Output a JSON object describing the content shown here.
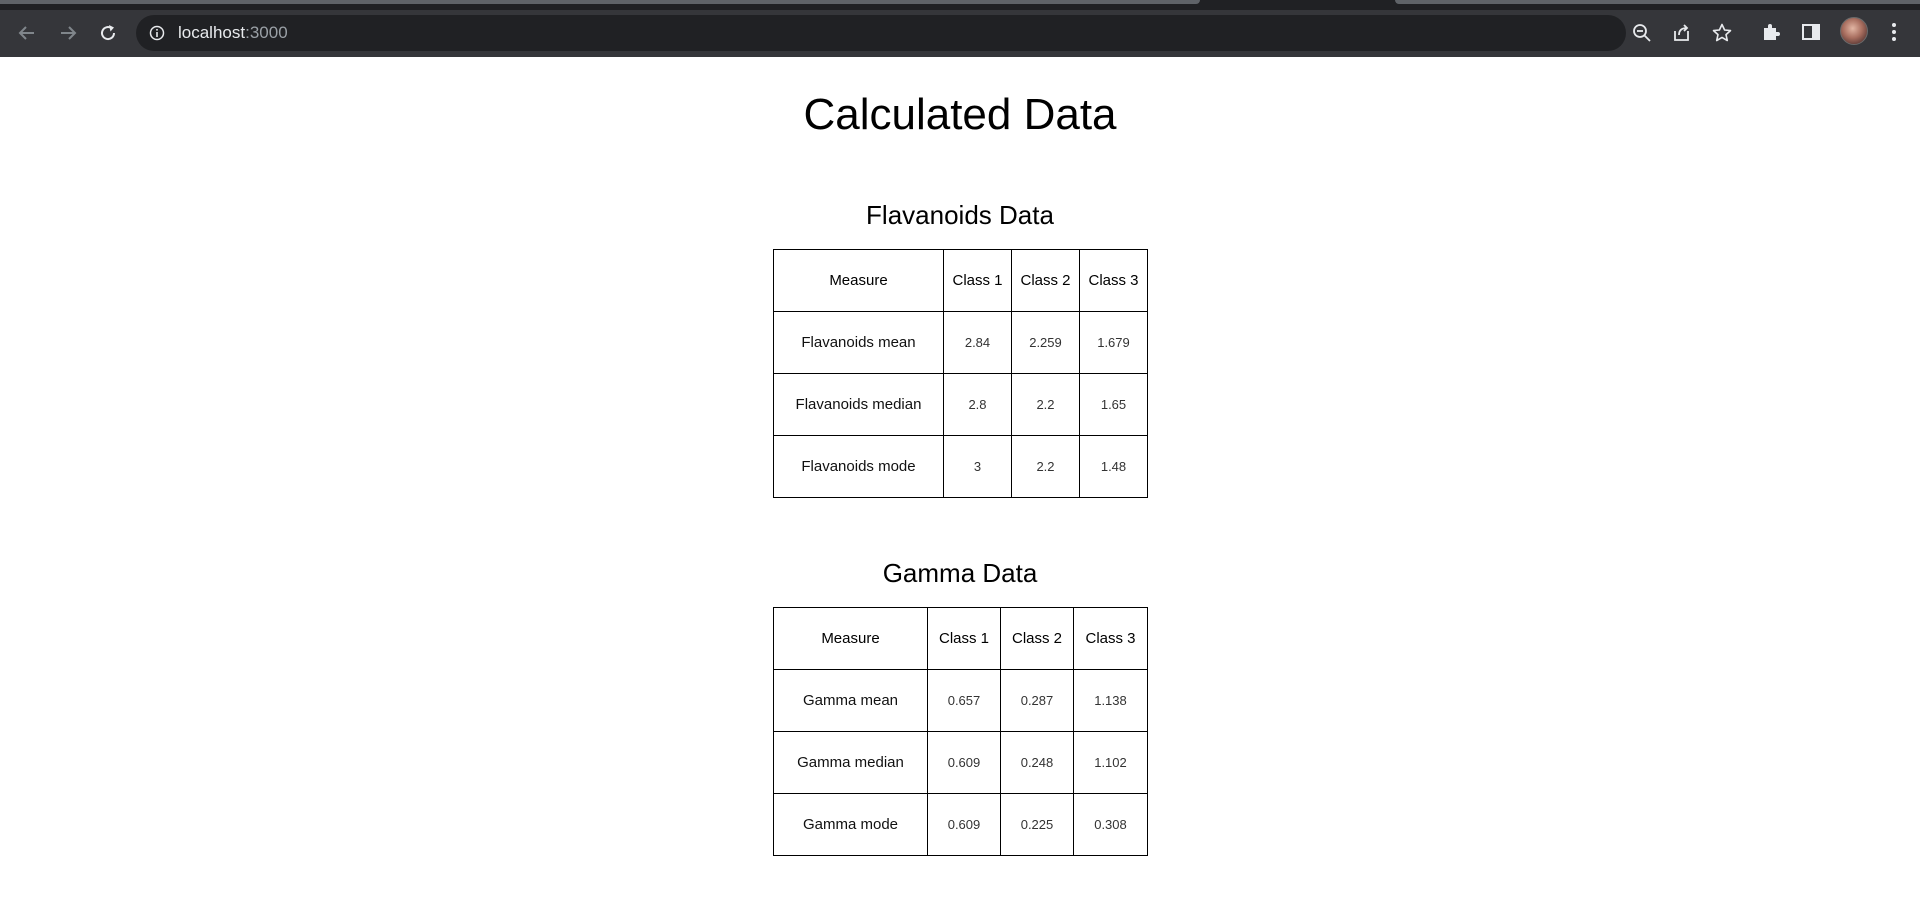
{
  "browser": {
    "url_host": "localhost",
    "url_port": ":3000"
  },
  "page": {
    "title": "Calculated Data"
  },
  "sections": [
    {
      "title": "Flavanoids Data",
      "headers": [
        "Measure",
        "Class 1",
        "Class 2",
        "Class 3"
      ],
      "rows": [
        {
          "measure": "Flavanoids mean",
          "values": [
            "2.84",
            "2.259",
            "1.679"
          ]
        },
        {
          "measure": "Flavanoids median",
          "values": [
            "2.8",
            "2.2",
            "1.65"
          ]
        },
        {
          "measure": "Flavanoids mode",
          "values": [
            "3",
            "2.2",
            "1.48"
          ]
        }
      ]
    },
    {
      "title": "Gamma Data",
      "headers": [
        "Measure",
        "Class 1",
        "Class 2",
        "Class 3"
      ],
      "rows": [
        {
          "measure": "Gamma mean",
          "values": [
            "0.657",
            "0.287",
            "1.138"
          ]
        },
        {
          "measure": "Gamma median",
          "values": [
            "0.609",
            "0.248",
            "1.102"
          ]
        },
        {
          "measure": "Gamma mode",
          "values": [
            "0.609",
            "0.225",
            "0.308"
          ]
        }
      ]
    }
  ]
}
